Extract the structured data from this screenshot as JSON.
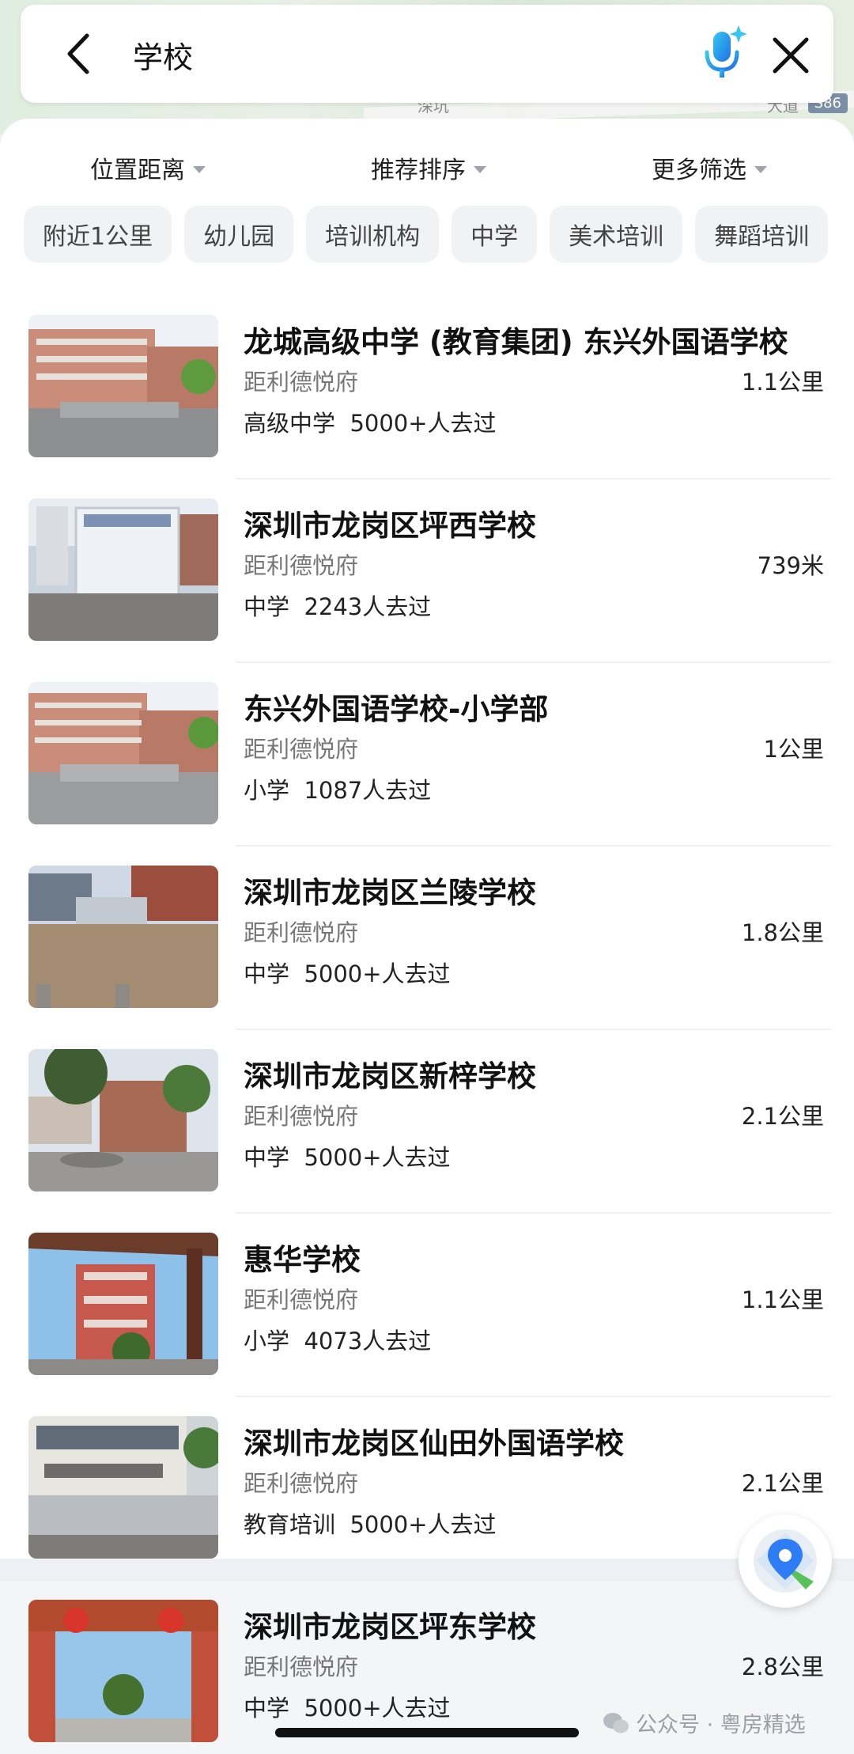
{
  "map": {
    "road_labels": [
      "深坑",
      "大道"
    ],
    "route_badge": "S86"
  },
  "search": {
    "query": "学校"
  },
  "filters": [
    {
      "label": "位置距离"
    },
    {
      "label": "推荐排序"
    },
    {
      "label": "更多筛选"
    }
  ],
  "chips": [
    "附近1公里",
    "幼儿园",
    "培训机构",
    "中学",
    "美术培训",
    "舞蹈培训"
  ],
  "results": [
    {
      "title": "龙城高级中学 (教育集团) 东兴外国语学校",
      "origin": "距利德悦府",
      "distance": "1.1公里",
      "category": "高级中学",
      "visitors": "5000+人去过"
    },
    {
      "title": "深圳市龙岗区坪西学校",
      "origin": "距利德悦府",
      "distance": "739米",
      "category": "中学",
      "visitors": "2243人去过"
    },
    {
      "title": "东兴外国语学校-小学部",
      "origin": "距利德悦府",
      "distance": "1公里",
      "category": "小学",
      "visitors": "1087人去过"
    },
    {
      "title": "深圳市龙岗区兰陵学校",
      "origin": "距利德悦府",
      "distance": "1.8公里",
      "category": "中学",
      "visitors": "5000+人去过"
    },
    {
      "title": "深圳市龙岗区新梓学校",
      "origin": "距利德悦府",
      "distance": "2.1公里",
      "category": "中学",
      "visitors": "5000+人去过"
    },
    {
      "title": "惠华学校",
      "origin": "距利德悦府",
      "distance": "1.1公里",
      "category": "小学",
      "visitors": "4073人去过"
    },
    {
      "title": "深圳市龙岗区仙田外国语学校",
      "origin": "距利德悦府",
      "distance": "2.1公里",
      "category": "教育培训",
      "visitors": "5000+人去过"
    },
    {
      "title": "深圳市龙岗区坪东学校",
      "origin": "距利德悦府",
      "distance": "2.8公里",
      "category": "中学",
      "visitors": "5000+人去过"
    }
  ],
  "watermark": {
    "text": "公众号 · 粤房精选"
  },
  "colors": {
    "accent": "#2e7cf6",
    "chip_bg": "#f1f2f4",
    "secondary_text": "#777777"
  }
}
